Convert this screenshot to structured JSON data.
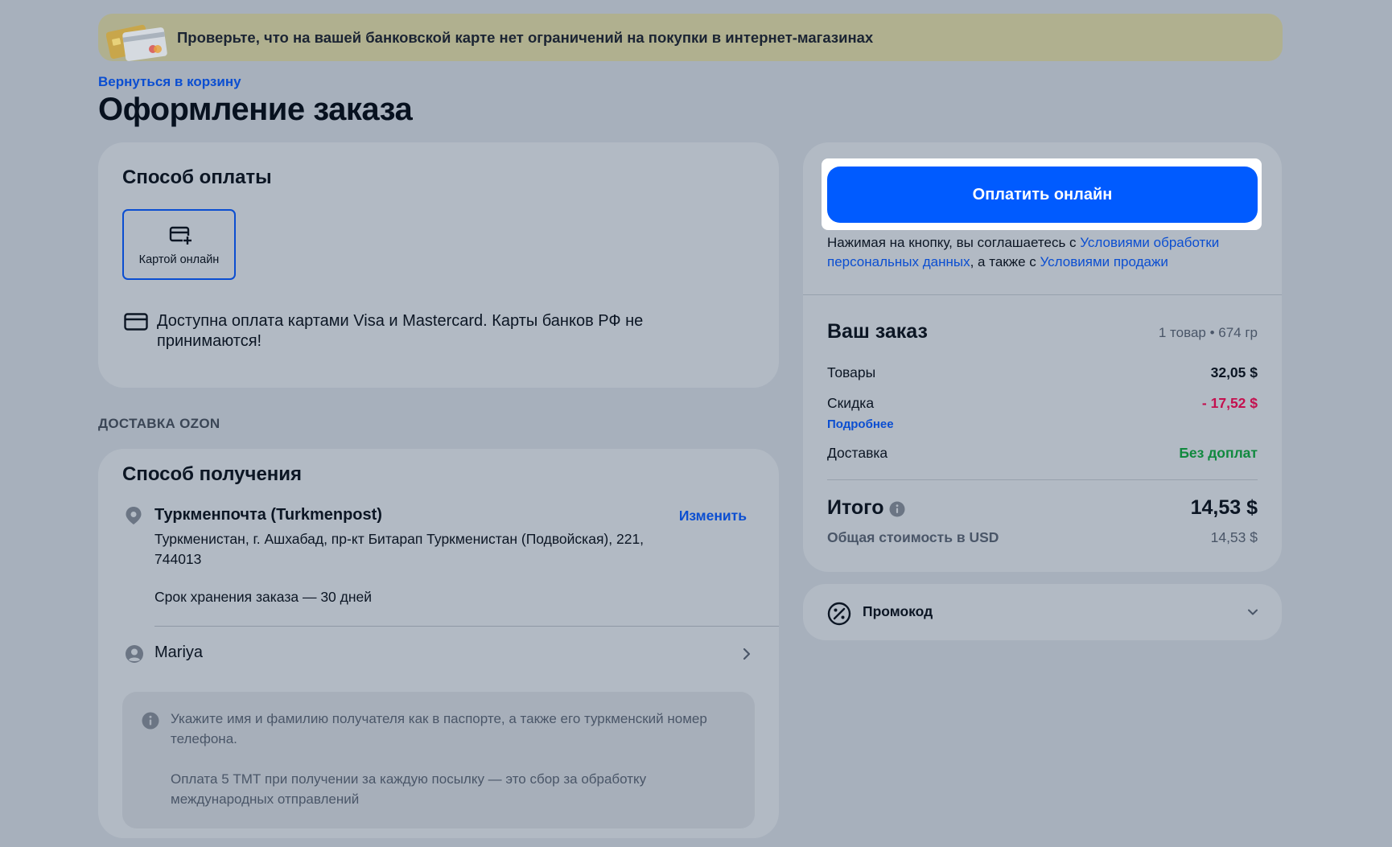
{
  "banner": {
    "text": "Проверьте, что на вашей банковской карте нет ограничений на покупки в интернет-магазинах"
  },
  "header": {
    "back_link": "Вернуться в корзину",
    "title": "Оформление заказа"
  },
  "payment": {
    "title": "Способ оплаты",
    "method_label": "Картой онлайн",
    "method_icon": "card-plus-icon",
    "note": "Доступна оплата картами Visa и Mastercard. Карты банков РФ не принимаются!",
    "note_icon": "credit-card-icon"
  },
  "delivery": {
    "section_label": "ДОСТАВКА OZON",
    "title": "Способ получения",
    "pickup_name": "Туркменпочта (Turkmenpost)",
    "change_label": "Изменить",
    "address": "Туркменистан, г. Ашхабад, пр-кт Битарап Туркменистан (Подвойская), 221, 744013",
    "storage": "Срок хранения заказа — 30 дней",
    "recipient_name": "Mariya",
    "info_1": "Укажите имя и фамилию получателя как в паспорте, а также его туркменский номер телефона.",
    "info_2": "Оплата 5 ТМТ при получении за каждую посылку — это сбор за обработку международных отправлений"
  },
  "summary": {
    "pay_button": "Оплатить онлайн",
    "agree_prefix": "Нажимая на кнопку, вы соглашаетесь с ",
    "agree_link_1": "Условиями обработки персональных данных",
    "agree_middle": ", а также с ",
    "agree_link_2": "Условиями продажи",
    "order_title": "Ваш заказ",
    "order_meta": "1 товар • 674 гр",
    "goods_label": "Товары",
    "goods_value": "32,05 $",
    "discount_label": "Скидка",
    "discount_value": "- 17,52 $",
    "details_link": "Подробнее",
    "delivery_label": "Доставка",
    "delivery_value": "Без доплат",
    "total_label": "Итого",
    "total_value": "14,53 $",
    "usd_label": "Общая стоимость в USD",
    "usd_value": "14,53 $"
  },
  "promo": {
    "label": "Промокод"
  },
  "colors": {
    "accent": "#005bff",
    "link": "#0b4ed1",
    "discount": "#c4104f",
    "success": "#10893e",
    "background": "#a7b0bc",
    "card": "#b2bac4"
  }
}
